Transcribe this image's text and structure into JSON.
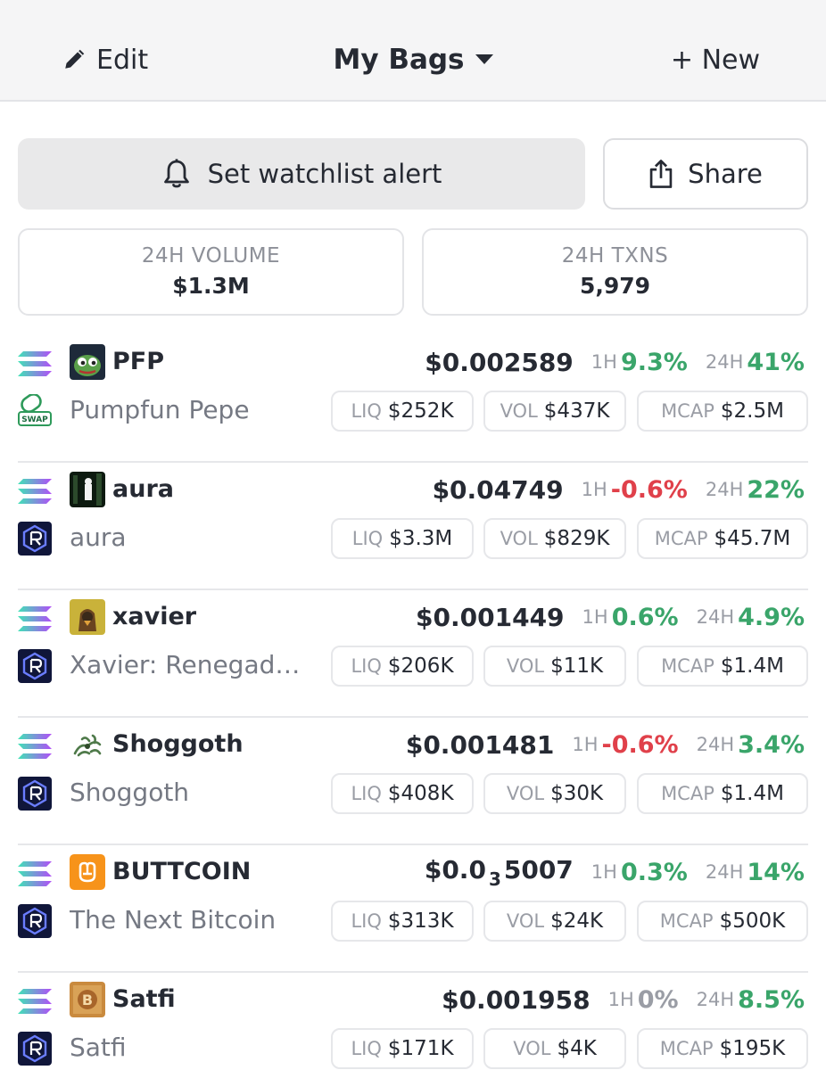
{
  "header": {
    "edit_label": "Edit",
    "title": "My Bags",
    "new_label": "+ New"
  },
  "actions": {
    "alert_label": "Set watchlist alert",
    "share_label": "Share"
  },
  "stats": {
    "volume": {
      "label": "24H VOLUME",
      "value": "$1.3M"
    },
    "txns": {
      "label": "24H TXNS",
      "value": "5,979"
    }
  },
  "labels": {
    "h1": "1H",
    "h24": "24H",
    "liq": "LIQ",
    "vol": "VOL",
    "mcap": "MCAP"
  },
  "tokens": [
    {
      "symbol": "PFP",
      "name": "Pumpfun Pepe",
      "dex_icon": "pump-swap-icon",
      "logo": "pepe-logo",
      "price": "$0.002589",
      "change_1h": "9.3%",
      "change_1h_dir": "pos",
      "change_24h": "41%",
      "change_24h_dir": "pos",
      "liq": "$252K",
      "vol": "$437K",
      "mcap": "$2.5M"
    },
    {
      "symbol": "aura",
      "name": "aura",
      "dex_icon": "raydium-icon",
      "logo": "aura-logo",
      "price": "$0.04749",
      "change_1h": "-0.6%",
      "change_1h_dir": "neg",
      "change_24h": "22%",
      "change_24h_dir": "pos",
      "liq": "$3.3M",
      "vol": "$829K",
      "mcap": "$45.7M"
    },
    {
      "symbol": "xavier",
      "name": "Xavier: Renegade Angel",
      "dex_icon": "raydium-icon",
      "logo": "xavier-logo",
      "price": "$0.001449",
      "change_1h": "0.6%",
      "change_1h_dir": "pos",
      "change_24h": "4.9%",
      "change_24h_dir": "pos",
      "liq": "$206K",
      "vol": "$11K",
      "mcap": "$1.4M"
    },
    {
      "symbol": "Shoggoth",
      "name": "Shoggoth",
      "dex_icon": "raydium-icon",
      "logo": "shoggoth-logo",
      "price": "$0.001481",
      "change_1h": "-0.6%",
      "change_1h_dir": "neg",
      "change_24h": "3.4%",
      "change_24h_dir": "pos",
      "liq": "$408K",
      "vol": "$30K",
      "mcap": "$1.4M"
    },
    {
      "symbol": "BUTTCOIN",
      "name": "The Next Bitcoin",
      "dex_icon": "raydium-icon",
      "logo": "buttcoin-logo",
      "price_head": "$0.0",
      "price_sub": "3",
      "price_tail": "5007",
      "change_1h": "0.3%",
      "change_1h_dir": "pos",
      "change_24h": "14%",
      "change_24h_dir": "pos",
      "liq": "$313K",
      "vol": "$24K",
      "mcap": "$500K"
    },
    {
      "symbol": "Satfi",
      "name": "Satfi",
      "dex_icon": "raydium-icon",
      "logo": "satfi-logo",
      "price": "$0.001958",
      "change_1h": "0%",
      "change_1h_dir": "zero",
      "change_24h": "8.5%",
      "change_24h_dir": "pos",
      "liq": "$171K",
      "vol": "$4K",
      "mcap": "$195K"
    }
  ],
  "colors": {
    "positive": "#3aa56a",
    "negative": "#e0404a",
    "neutral": "#9a9da5",
    "text": "#262a33"
  }
}
